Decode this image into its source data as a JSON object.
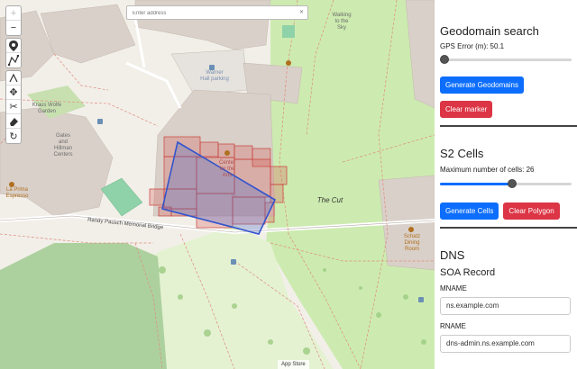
{
  "map": {
    "address_placeholder": "Enter address",
    "address_clear_icon": "close-icon",
    "zoom_in": "+",
    "zoom_out": "−",
    "tools": [
      "marker-icon",
      "polyline-icon",
      "draw-icon",
      "move-icon",
      "cut-icon",
      "eraser-icon",
      "rotate-icon"
    ],
    "labels": {
      "walking": "Walking\nto the\nSky",
      "warner": "Warner\nHall parking",
      "kraus": "Kraus Wolfe\nGarden",
      "gates": "Gates\nand\nHillman\nCenters",
      "laprima": "La Prima\nEspresso",
      "center": "Center\nfor the\nArts",
      "cut": "The Cut",
      "bridge": "Randy Pausch Memorial Bridge",
      "schatz": "Schatz\nDining\nRoom"
    },
    "attribution": "App Store"
  },
  "geodomain": {
    "title": "Geodomain search",
    "gps_error_label": "GPS Error (m): 50.1",
    "gps_error_value": 50.1,
    "gps_error_fraction": 0.0,
    "generate_label": "Generate Geodomains",
    "clear_label": "Clear marker"
  },
  "s2": {
    "title": "S2 Cells",
    "max_cells_label": "Maximum number of cells: 26",
    "max_cells_value": 26,
    "max_cells_fraction": 0.55,
    "generate_label": "Generate Cells",
    "clear_label": "Clear Polygon"
  },
  "dns": {
    "title": "DNS",
    "soa_title": "SOA Record",
    "mname_label": "MNAME",
    "mname_value": "ns.example.com",
    "rname_label": "RNAME",
    "rname_value": "dns-admin.ns.example.com"
  },
  "colors": {
    "primary": "#0d6efd",
    "danger": "#dc3545",
    "polygon_stroke": "#3355cc",
    "cell_stroke": "#d9534f"
  }
}
